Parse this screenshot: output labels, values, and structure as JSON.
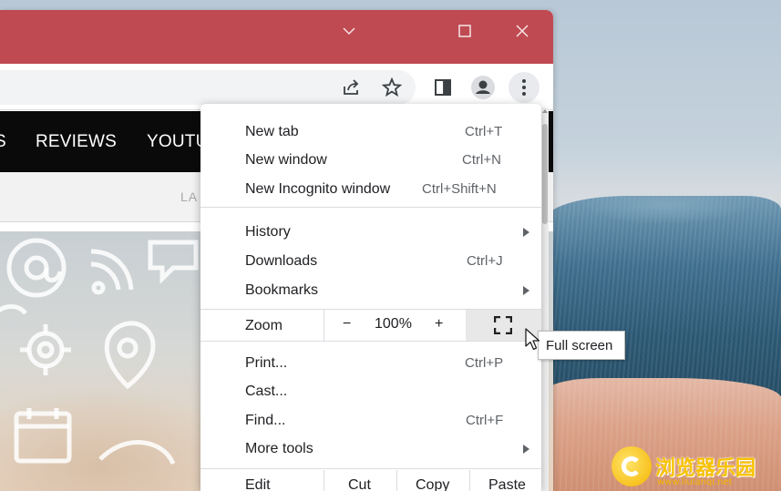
{
  "site_nav": {
    "items": [
      {
        "label": "S"
      },
      {
        "label": "REVIEWS"
      },
      {
        "label": "YOUTU"
      }
    ],
    "sub_text": "LA"
  },
  "menu": {
    "items": [
      {
        "label": "New tab",
        "shortcut": "Ctrl+T"
      },
      {
        "label": "New window",
        "shortcut": "Ctrl+N"
      },
      {
        "label": "New Incognito window",
        "shortcut": "Ctrl+Shift+N"
      },
      {
        "label": "History",
        "shortcut": ""
      },
      {
        "label": "Downloads",
        "shortcut": "Ctrl+J"
      },
      {
        "label": "Bookmarks",
        "shortcut": ""
      },
      {
        "label": "Print...",
        "shortcut": "Ctrl+P"
      },
      {
        "label": "Cast...",
        "shortcut": ""
      },
      {
        "label": "Find...",
        "shortcut": "Ctrl+F"
      },
      {
        "label": "More tools",
        "shortcut": ""
      }
    ],
    "zoom": {
      "label": "Zoom",
      "minus": "−",
      "value": "100%",
      "plus": "+",
      "fullscreen_icon": "fullscreen-icon"
    },
    "edit": {
      "label": "Edit",
      "cut": "Cut",
      "copy": "Copy",
      "paste": "Paste"
    }
  },
  "tooltip": {
    "text": "Full screen"
  },
  "watermark": {
    "text": "浏览器乐园",
    "url": "www.liulanqi.net"
  },
  "colors": {
    "titlebar": "#bf4a52",
    "nav_bg": "#0a0a0a",
    "menu_bg": "#ffffff",
    "accent": "#f5b400"
  },
  "icons": {
    "window_controls": [
      "chevron-down-icon",
      "maximize-icon",
      "close-icon"
    ],
    "toolbar": [
      "share-icon",
      "star-icon",
      "side-panel-icon",
      "profile-icon",
      "kebab-menu-icon"
    ]
  }
}
